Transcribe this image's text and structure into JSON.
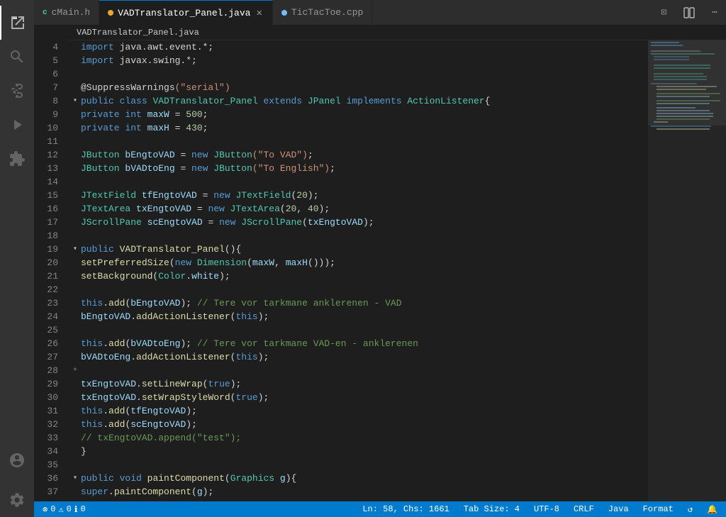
{
  "tabs": [
    {
      "label": "cMain.h",
      "icon": "c-icon",
      "color": "blue",
      "active": false,
      "closeable": false
    },
    {
      "label": "VADTranslator_Panel.java",
      "icon": "java-icon",
      "color": "orange",
      "active": true,
      "closeable": true
    },
    {
      "label": "TicTacToe.cpp",
      "icon": "cpp-icon",
      "color": "blue",
      "active": false,
      "closeable": false
    }
  ],
  "breadcrumb": {
    "path": "VADTranslator_Panel.java"
  },
  "toolbar_icons": {
    "remote": "⊡",
    "split": "⧉",
    "more": "⋯"
  },
  "code": {
    "lines": [
      {
        "num": 4,
        "indent": 0,
        "tokens": [
          {
            "t": "kw",
            "v": "import"
          },
          {
            "t": "punct",
            "v": " java.awt.event.*;"
          }
        ]
      },
      {
        "num": 5,
        "indent": 0,
        "tokens": [
          {
            "t": "kw",
            "v": "import"
          },
          {
            "t": "punct",
            "v": " javax.swing.*;"
          }
        ]
      },
      {
        "num": 6,
        "indent": 0,
        "tokens": []
      },
      {
        "num": 7,
        "indent": 0,
        "tokens": [
          {
            "t": "annotation",
            "v": "@SuppressWarnings"
          },
          {
            "t": "str",
            "v": "(\"serial\")"
          }
        ]
      },
      {
        "num": 8,
        "fold": true,
        "indent": 0,
        "tokens": [
          {
            "t": "kw",
            "v": "public"
          },
          {
            "t": "punct",
            "v": " "
          },
          {
            "t": "kw",
            "v": "class"
          },
          {
            "t": "punct",
            "v": " "
          },
          {
            "t": "cls",
            "v": "VADTranslator_Panel"
          },
          {
            "t": "punct",
            "v": " "
          },
          {
            "t": "kw",
            "v": "extends"
          },
          {
            "t": "punct",
            "v": " "
          },
          {
            "t": "cls",
            "v": "JPanel"
          },
          {
            "t": "punct",
            "v": " "
          },
          {
            "t": "kw",
            "v": "implements"
          },
          {
            "t": "punct",
            "v": " "
          },
          {
            "t": "cls",
            "v": "ActionListener"
          },
          {
            "t": "punct",
            "v": "{"
          }
        ]
      },
      {
        "num": 9,
        "indent": 2,
        "tokens": [
          {
            "t": "kw",
            "v": "private"
          },
          {
            "t": "punct",
            "v": " "
          },
          {
            "t": "kw",
            "v": "int"
          },
          {
            "t": "punct",
            "v": " "
          },
          {
            "t": "var",
            "v": "maxW"
          },
          {
            "t": "punct",
            "v": " = "
          },
          {
            "t": "num",
            "v": "500"
          },
          {
            "t": "punct",
            "v": ";"
          }
        ]
      },
      {
        "num": 10,
        "indent": 2,
        "tokens": [
          {
            "t": "kw",
            "v": "private"
          },
          {
            "t": "punct",
            "v": " "
          },
          {
            "t": "kw",
            "v": "int"
          },
          {
            "t": "punct",
            "v": " "
          },
          {
            "t": "var",
            "v": "maxH"
          },
          {
            "t": "punct",
            "v": " = "
          },
          {
            "t": "num",
            "v": "430"
          },
          {
            "t": "punct",
            "v": ";"
          }
        ]
      },
      {
        "num": 11,
        "indent": 0,
        "tokens": []
      },
      {
        "num": 12,
        "indent": 2,
        "tokens": [
          {
            "t": "cls",
            "v": "JButton"
          },
          {
            "t": "punct",
            "v": " "
          },
          {
            "t": "var",
            "v": "bEngtoVAD"
          },
          {
            "t": "punct",
            "v": " = "
          },
          {
            "t": "kw",
            "v": "new"
          },
          {
            "t": "punct",
            "v": " "
          },
          {
            "t": "cls",
            "v": "JButton"
          },
          {
            "t": "str",
            "v": "(\"To VAD\")"
          },
          {
            "t": "punct",
            "v": ";"
          }
        ]
      },
      {
        "num": 13,
        "indent": 2,
        "tokens": [
          {
            "t": "cls",
            "v": "JButton"
          },
          {
            "t": "punct",
            "v": " "
          },
          {
            "t": "var",
            "v": "bVADtoEng"
          },
          {
            "t": "punct",
            "v": " = "
          },
          {
            "t": "kw",
            "v": "new"
          },
          {
            "t": "punct",
            "v": " "
          },
          {
            "t": "cls",
            "v": "JButton"
          },
          {
            "t": "str",
            "v": "(\"To English\")"
          },
          {
            "t": "punct",
            "v": ";"
          }
        ]
      },
      {
        "num": 14,
        "indent": 0,
        "tokens": []
      },
      {
        "num": 15,
        "indent": 2,
        "tokens": [
          {
            "t": "cls",
            "v": "JTextField"
          },
          {
            "t": "punct",
            "v": " "
          },
          {
            "t": "var",
            "v": "tfEngtoVAD"
          },
          {
            "t": "punct",
            "v": " = "
          },
          {
            "t": "kw",
            "v": "new"
          },
          {
            "t": "punct",
            "v": " "
          },
          {
            "t": "cls",
            "v": "JTextField"
          },
          {
            "t": "punct",
            "v": "("
          },
          {
            "t": "num",
            "v": "20"
          },
          {
            "t": "punct",
            "v": ");"
          }
        ]
      },
      {
        "num": 16,
        "indent": 2,
        "tokens": [
          {
            "t": "cls",
            "v": "JTextArea"
          },
          {
            "t": "punct",
            "v": " "
          },
          {
            "t": "var",
            "v": "txEngtoVAD"
          },
          {
            "t": "punct",
            "v": " = "
          },
          {
            "t": "kw",
            "v": "new"
          },
          {
            "t": "punct",
            "v": " "
          },
          {
            "t": "cls",
            "v": "JTextArea"
          },
          {
            "t": "punct",
            "v": "("
          },
          {
            "t": "num",
            "v": "20"
          },
          {
            "t": "punct",
            "v": ", "
          },
          {
            "t": "num",
            "v": "40"
          },
          {
            "t": "punct",
            "v": ");"
          }
        ]
      },
      {
        "num": 17,
        "indent": 2,
        "tokens": [
          {
            "t": "cls",
            "v": "JScrollPane"
          },
          {
            "t": "punct",
            "v": " "
          },
          {
            "t": "var",
            "v": "scEngtoVAD"
          },
          {
            "t": "punct",
            "v": " = "
          },
          {
            "t": "kw",
            "v": "new"
          },
          {
            "t": "punct",
            "v": " "
          },
          {
            "t": "cls",
            "v": "JScrollPane"
          },
          {
            "t": "punct",
            "v": "("
          },
          {
            "t": "var",
            "v": "txEngtoVAD"
          },
          {
            "t": "punct",
            "v": ");"
          }
        ]
      },
      {
        "num": 18,
        "indent": 0,
        "tokens": []
      },
      {
        "num": 19,
        "fold": true,
        "indent": 1,
        "tokens": [
          {
            "t": "kw",
            "v": "public"
          },
          {
            "t": "punct",
            "v": " "
          },
          {
            "t": "fn",
            "v": "VADTranslator_Panel"
          },
          {
            "t": "punct",
            "v": "(){"
          }
        ]
      },
      {
        "num": 20,
        "indent": 3,
        "tokens": [
          {
            "t": "fn",
            "v": "setPreferredSize"
          },
          {
            "t": "punct",
            "v": "("
          },
          {
            "t": "kw",
            "v": "new"
          },
          {
            "t": "punct",
            "v": " "
          },
          {
            "t": "cls",
            "v": "Dimension"
          },
          {
            "t": "punct",
            "v": "("
          },
          {
            "t": "var",
            "v": "maxW"
          },
          {
            "t": "punct",
            "v": ", "
          },
          {
            "t": "var",
            "v": "maxH"
          },
          {
            "t": "punct",
            "v": "()));"
          }
        ]
      },
      {
        "num": 21,
        "indent": 3,
        "tokens": [
          {
            "t": "fn",
            "v": "setBackground"
          },
          {
            "t": "punct",
            "v": "("
          },
          {
            "t": "cls",
            "v": "Color"
          },
          {
            "t": "punct",
            "v": "."
          },
          {
            "t": "var",
            "v": "white"
          },
          {
            "t": "punct",
            "v": ");"
          }
        ]
      },
      {
        "num": 22,
        "indent": 0,
        "tokens": []
      },
      {
        "num": 23,
        "indent": 3,
        "tokens": [
          {
            "t": "kw",
            "v": "this"
          },
          {
            "t": "punct",
            "v": "."
          },
          {
            "t": "fn",
            "v": "add"
          },
          {
            "t": "punct",
            "v": "("
          },
          {
            "t": "var",
            "v": "bEngtoVAD"
          },
          {
            "t": "punct",
            "v": "); "
          },
          {
            "t": "comment",
            "v": "// Tere vor tarkmane anklerenen - VAD"
          }
        ]
      },
      {
        "num": 24,
        "indent": 3,
        "tokens": [
          {
            "t": "var",
            "v": "bEngtoVAD"
          },
          {
            "t": "punct",
            "v": "."
          },
          {
            "t": "fn",
            "v": "addActionListener"
          },
          {
            "t": "punct",
            "v": "("
          },
          {
            "t": "kw",
            "v": "this"
          },
          {
            "t": "punct",
            "v": ");"
          }
        ]
      },
      {
        "num": 25,
        "indent": 0,
        "tokens": []
      },
      {
        "num": 26,
        "indent": 3,
        "tokens": [
          {
            "t": "kw",
            "v": "this"
          },
          {
            "t": "punct",
            "v": "."
          },
          {
            "t": "fn",
            "v": "add"
          },
          {
            "t": "punct",
            "v": "("
          },
          {
            "t": "var",
            "v": "bVADtoEng"
          },
          {
            "t": "punct",
            "v": "); "
          },
          {
            "t": "comment",
            "v": "// Tere vor tarkmane VAD-en - anklerenen"
          }
        ]
      },
      {
        "num": 27,
        "indent": 3,
        "tokens": [
          {
            "t": "var",
            "v": "bVADtoEng"
          },
          {
            "t": "punct",
            "v": "."
          },
          {
            "t": "fn",
            "v": "addActionListener"
          },
          {
            "t": "punct",
            "v": "("
          },
          {
            "t": "kw",
            "v": "this"
          },
          {
            "t": "punct",
            "v": ");"
          }
        ]
      },
      {
        "num": 28,
        "fold_close": true,
        "indent": 1,
        "tokens": []
      },
      {
        "num": 29,
        "indent": 3,
        "tokens": [
          {
            "t": "var",
            "v": "txEngtoVAD"
          },
          {
            "t": "punct",
            "v": "."
          },
          {
            "t": "fn",
            "v": "setLineWrap"
          },
          {
            "t": "punct",
            "v": "("
          },
          {
            "t": "kw",
            "v": "true"
          },
          {
            "t": "punct",
            "v": ");"
          }
        ]
      },
      {
        "num": 30,
        "indent": 3,
        "tokens": [
          {
            "t": "var",
            "v": "txEngtoVAD"
          },
          {
            "t": "punct",
            "v": "."
          },
          {
            "t": "fn",
            "v": "setWrapStyleWord"
          },
          {
            "t": "punct",
            "v": "("
          },
          {
            "t": "kw",
            "v": "true"
          },
          {
            "t": "punct",
            "v": ");"
          }
        ]
      },
      {
        "num": 31,
        "indent": 3,
        "tokens": [
          {
            "t": "kw",
            "v": "this"
          },
          {
            "t": "punct",
            "v": "."
          },
          {
            "t": "fn",
            "v": "add"
          },
          {
            "t": "punct",
            "v": "("
          },
          {
            "t": "var",
            "v": "tfEngtoVAD"
          },
          {
            "t": "punct",
            "v": ");"
          }
        ]
      },
      {
        "num": 32,
        "indent": 3,
        "tokens": [
          {
            "t": "kw",
            "v": "this"
          },
          {
            "t": "punct",
            "v": "."
          },
          {
            "t": "fn",
            "v": "add"
          },
          {
            "t": "punct",
            "v": "("
          },
          {
            "t": "var",
            "v": "scEngtoVAD"
          },
          {
            "t": "punct",
            "v": ");"
          }
        ]
      },
      {
        "num": 33,
        "indent": 3,
        "tokens": [
          {
            "t": "comment",
            "v": "// txEngtoVAD.append(\"test\");"
          }
        ]
      },
      {
        "num": 34,
        "indent": 2,
        "tokens": [
          {
            "t": "punct",
            "v": "}"
          }
        ]
      },
      {
        "num": 35,
        "indent": 0,
        "tokens": []
      },
      {
        "num": 36,
        "fold": true,
        "indent": 1,
        "tokens": [
          {
            "t": "kw",
            "v": "public"
          },
          {
            "t": "punct",
            "v": " "
          },
          {
            "t": "kw",
            "v": "void"
          },
          {
            "t": "punct",
            "v": " "
          },
          {
            "t": "fn",
            "v": "paintComponent"
          },
          {
            "t": "punct",
            "v": "("
          },
          {
            "t": "cls",
            "v": "Graphics"
          },
          {
            "t": "punct",
            "v": " "
          },
          {
            "t": "var",
            "v": "g"
          },
          {
            "t": "punct",
            "v": "){"
          }
        ]
      },
      {
        "num": 37,
        "indent": 3,
        "tokens": [
          {
            "t": "kw",
            "v": "super"
          },
          {
            "t": "punct",
            "v": "."
          },
          {
            "t": "fn",
            "v": "paintComponent"
          },
          {
            "t": "punct",
            "v": "("
          },
          {
            "t": "var",
            "v": "g"
          },
          {
            "t": "punct",
            "v": ");"
          }
        ]
      }
    ]
  },
  "status": {
    "errors": "0",
    "warnings": "0",
    "info": "0",
    "position": "Ln: 58, Chs: 1661",
    "tab_size": "Tab Size: 4",
    "encoding": "UTF-8",
    "line_ending": "CRLF",
    "language": "Java",
    "format": "Format",
    "bell": "🔔",
    "sync": "↺"
  },
  "activity": {
    "items": [
      {
        "name": "explorer",
        "icon": "📋"
      },
      {
        "name": "search",
        "icon": "🔍"
      },
      {
        "name": "source-control",
        "icon": "⑂"
      },
      {
        "name": "run",
        "icon": "▷"
      },
      {
        "name": "extensions",
        "icon": "⊞"
      }
    ],
    "bottom": [
      {
        "name": "account",
        "icon": "👤"
      },
      {
        "name": "settings",
        "icon": "⚙"
      }
    ]
  }
}
